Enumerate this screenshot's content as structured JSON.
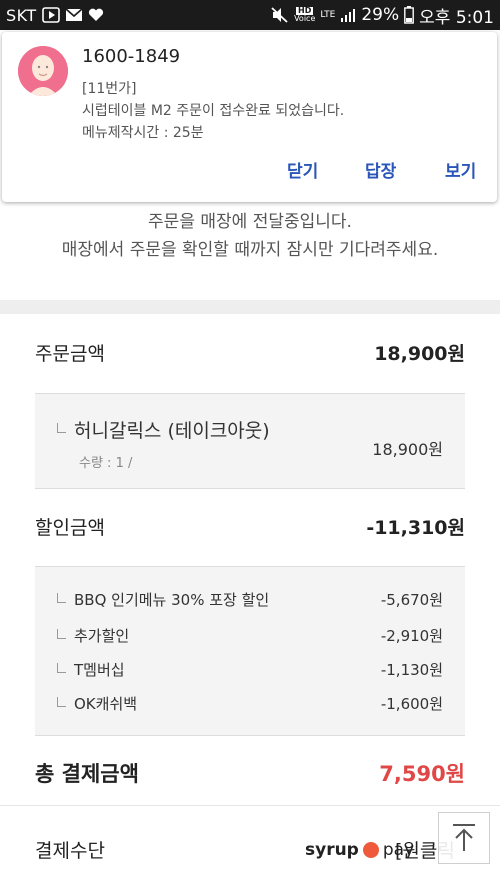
{
  "status_bar": {
    "carrier": "SKT",
    "hd_label": "HD",
    "voice_label": "Voice",
    "lte_label": "LTE",
    "battery": "29%",
    "time": "오후 5:01"
  },
  "notification": {
    "sender": "1600-1849",
    "line1": "[11번가]",
    "line2": "시럽테이블 M2 주문이 접수완료 되었습니다.",
    "line3": "메뉴제작시간 : 25분",
    "actions": {
      "close": "닫기",
      "reply": "답장",
      "view": "보기"
    }
  },
  "order_message": {
    "line1": "주문을 매장에 전달중입니다.",
    "line2": "매장에서 주문을 확인할 때까지 잠시만 기다려주세요."
  },
  "summary": {
    "order_amount_label": "주문금액",
    "order_amount_value": "18,900원",
    "menu_item": {
      "name": "허니갈릭스 (테이크아웃)",
      "quantity": "수량 : 1 /",
      "price": "18,900원"
    },
    "discount_label": "할인금액",
    "discount_value": "-11,310원",
    "discounts": [
      {
        "name": "BBQ 인기메뉴 30% 포장 할인",
        "amount": "-5,670원"
      },
      {
        "name": "추가할인",
        "amount": "-2,910원"
      },
      {
        "name": "T멤버십",
        "amount": "-1,130원"
      },
      {
        "name": "OK캐쉬백",
        "amount": "-1,600원"
      }
    ],
    "total_label": "총 결제금액",
    "total_value": "7,590원",
    "total_color": "#e04848"
  },
  "payment": {
    "label": "결제수단",
    "brand_syrup": "syrup",
    "brand_pay": "pay",
    "option": "[원클릭"
  },
  "accent_color": "#2a56b8"
}
